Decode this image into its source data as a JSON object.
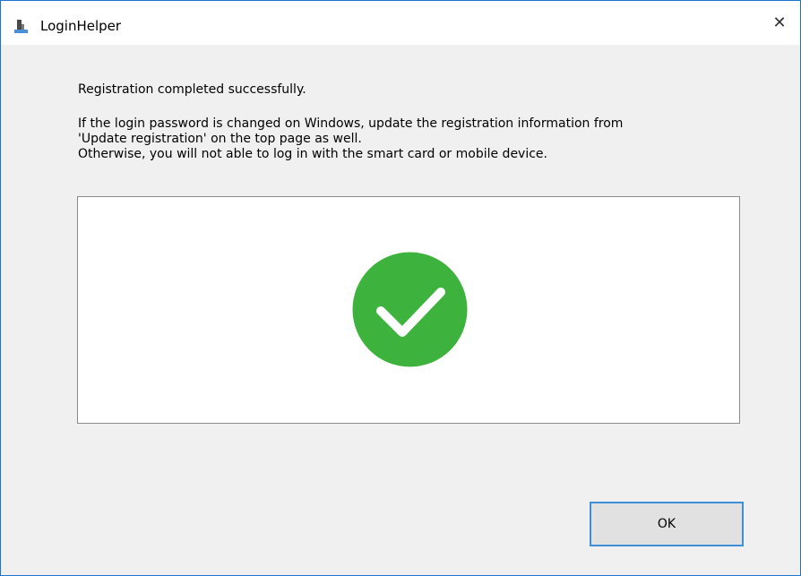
{
  "window": {
    "title": "LoginHelper",
    "app_icon": "login-helper-app-icon",
    "close_icon": "close-icon",
    "close_glyph": "✕"
  },
  "message": {
    "title": "Registration completed successfully.",
    "lines": [
      "If the login password is changed on Windows, update the registration information from",
      "'Update registration' on the top page as well.",
      "Otherwise, you will not able to log in with the smart card or mobile device."
    ]
  },
  "result": {
    "icon": "success-checkmark-icon",
    "icon_color": "#3db33d"
  },
  "buttons": {
    "ok_label": "OK"
  },
  "colors": {
    "window_border": "#1a74d0",
    "dialog_background": "#f0f0f0",
    "button_focus_border": "#3d8fd8"
  }
}
